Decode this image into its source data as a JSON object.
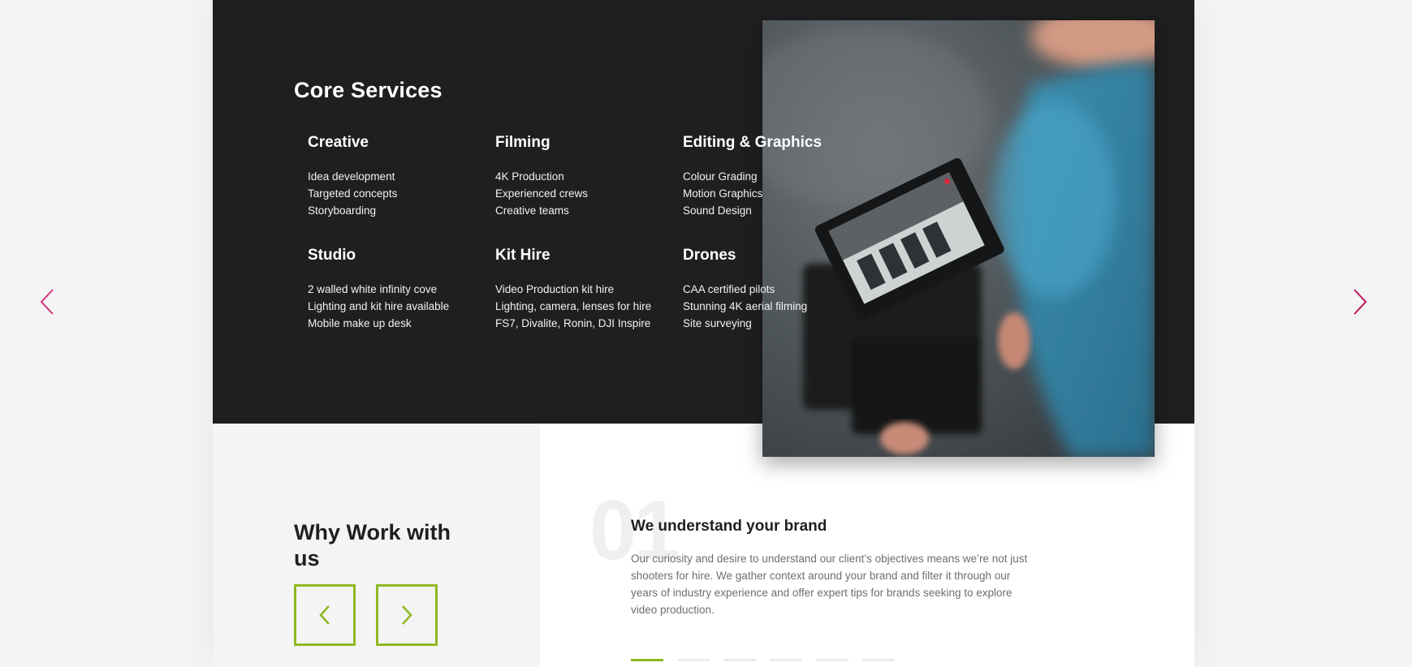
{
  "nav": {
    "outer_prev_icon": "chevron-left-icon",
    "outer_next_icon": "chevron-right-icon",
    "arrow_color": "#d6317f"
  },
  "core_services": {
    "title": "Core Services",
    "groups": [
      {
        "title": "Creative",
        "items": [
          "Idea development",
          "Targeted concepts",
          "Storyboarding"
        ]
      },
      {
        "title": "Filming",
        "items": [
          "4K Production",
          "Experienced crews",
          "Creative teams"
        ]
      },
      {
        "title": "Editing & Graphics",
        "items": [
          "Colour Grading",
          "Motion Graphics",
          "Sound Design"
        ]
      },
      {
        "title": "Studio",
        "items": [
          "2 walled white infinity cove",
          "Lighting and kit hire available",
          "Mobile make up desk"
        ]
      },
      {
        "title": "Kit Hire",
        "items": [
          "Video Production kit hire",
          "Lighting, camera, lenses for hire",
          "FS7, Divalite, Ronin, DJI Inspire"
        ]
      },
      {
        "title": "Drones",
        "items": [
          "CAA certified pilots",
          "Stunning 4K aerial filming",
          "Site surveying"
        ]
      }
    ]
  },
  "why": {
    "title": "Why Work with us",
    "prev_icon": "chevron-left-icon",
    "next_icon": "chevron-right-icon",
    "accent": "#8fb820"
  },
  "point": {
    "number": "01",
    "title": "We understand your brand",
    "body": "Our curiosity and desire to understand our client’s objectives means we’re not just shooters for hire. We gather context around your brand and filter it through our years of industry experience and offer expert tips for brands seeking to explore video production.",
    "dots_total": 6,
    "dots_active": 1
  }
}
